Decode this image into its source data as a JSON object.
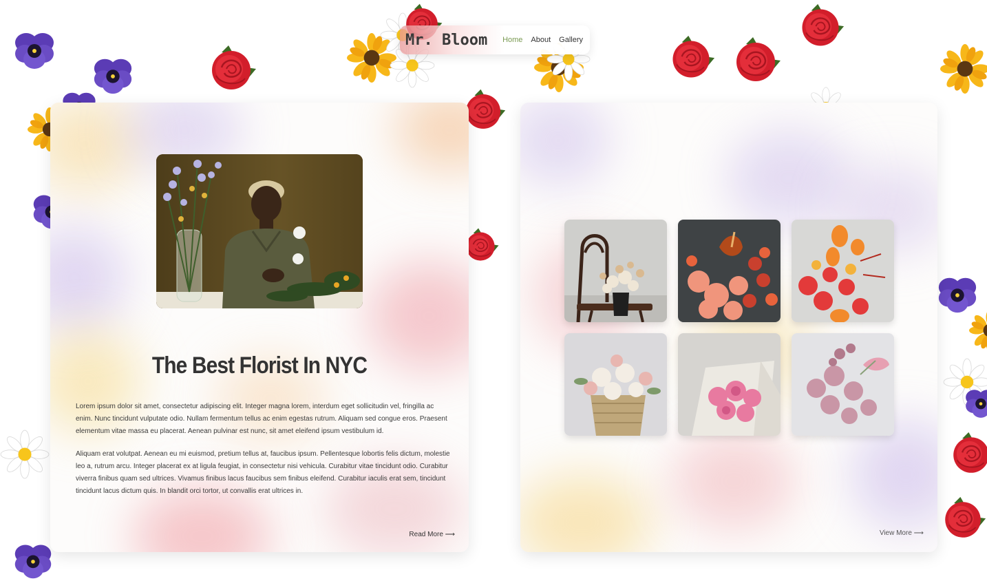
{
  "nav": {
    "logo": "Mr. Bloom",
    "links": [
      {
        "label": "Home",
        "active": true
      },
      {
        "label": "About",
        "active": false
      },
      {
        "label": "Gallery",
        "active": false
      }
    ]
  },
  "hero": {
    "image_icon": "florist-photo",
    "title": "The Best Florist In NYC",
    "paragraphs": [
      "Lorem ipsum dolor sit amet, consectetur adipiscing elit. Integer magna lorem, interdum eget sollicitudin vel, fringilla ac enim. Nunc tincidunt vulputate odio. Nullam fermentum tellus ac enim egestas rutrum. Aliquam sed congue eros. Praesent elementum vitae massa eu placerat. Aenean pulvinar est nunc, sit amet eleifend ipsum vestibulum id.",
      "Aliquam erat volutpat. Aenean eu mi euismod, pretium tellus at, faucibus ipsum. Pellentesque lobortis felis dictum, molestie leo a, rutrum arcu. Integer placerat ex at ligula feugiat, in consectetur nisi vehicula. Curabitur vitae tincidunt odio. Curabitur viverra finibus quam sed ultrices. Vivamus finibus lacus faucibus sem finibus eleifend. Curabitur iaculis erat sem, tincidunt tincidunt lacus dictum quis. In blandit orci tortor, ut convallis erat ultrices in."
    ],
    "read_more": "Read More ⟶"
  },
  "gallery": {
    "tiles": [
      {
        "icon": "dried-bouquet-on-chair-photo"
      },
      {
        "icon": "coral-bouquet-photo"
      },
      {
        "icon": "red-tulip-bouquet-photo"
      },
      {
        "icon": "basket-roses-photo"
      },
      {
        "icon": "pink-peony-wrap-photo"
      },
      {
        "icon": "pink-chrysanthemum-photo"
      }
    ],
    "view_more": "View More ⟶"
  },
  "colors": {
    "accent_green": "#7a9a52",
    "rose_red": "#d8232f",
    "pansy_purple": "#5a3fb0",
    "sunflower_yellow": "#f5b312",
    "text_dark": "#333333"
  }
}
